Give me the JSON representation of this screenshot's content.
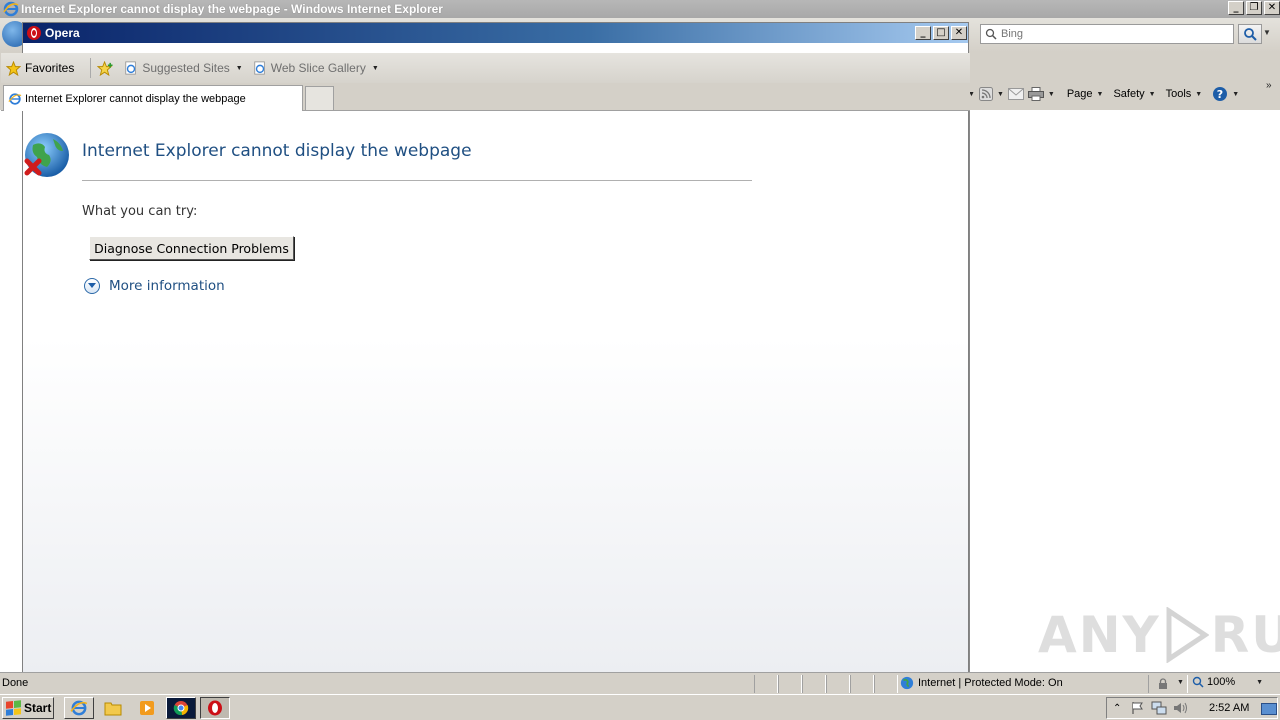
{
  "ie_window": {
    "title": "Internet Explorer cannot display the webpage - Windows Internet Explorer",
    "search_placeholder": "Bing",
    "commands": {
      "page": "Page",
      "safety": "Safety",
      "tools": "Tools"
    }
  },
  "opera_window": {
    "title": "Opera",
    "favorites": {
      "favorites_label": "Favorites",
      "suggested_sites": "Suggested Sites",
      "web_slice_gallery": "Web Slice Gallery"
    },
    "tab_title": "Internet Explorer cannot display the webpage"
  },
  "error_page": {
    "heading": "Internet Explorer cannot display the webpage",
    "what_you_can_try": "What you can try:",
    "diagnose_button": "Diagnose Connection Problems",
    "more_information": "More information"
  },
  "status_bar": {
    "status": "Done",
    "zone": "Internet | Protected Mode: On",
    "zoom": "100%"
  },
  "taskbar": {
    "start_label": "Start",
    "clock": "2:52 AM"
  },
  "watermark": {
    "text_left": "ANY",
    "text_right": "RUN"
  }
}
